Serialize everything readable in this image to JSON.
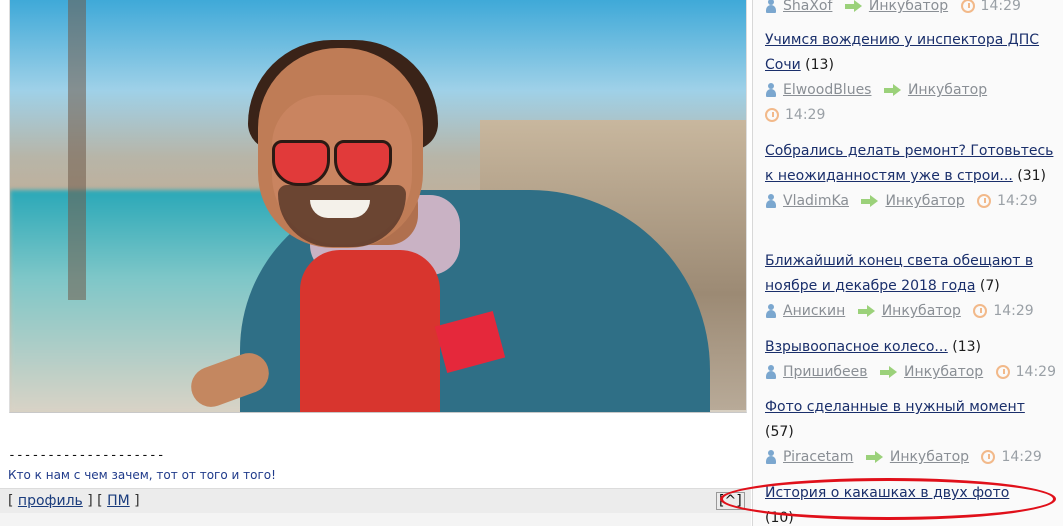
{
  "post": {
    "dashes": "--------------------",
    "signature": "Кто к нам с чем зачем, тот от того и того!",
    "bracket_open": "[",
    "bracket_close": "]",
    "profile_link": "профиль",
    "pm_link": "ПМ",
    "up_button": "[^]"
  },
  "feed": {
    "items": [
      {
        "title": "",
        "count": "",
        "user": "ShaXof",
        "forum": "Инкубатор",
        "time": "14:29"
      },
      {
        "title": "Учимся вождению у инспектора ДПС Сочи",
        "count": "(13)",
        "user": "ElwoodBlues",
        "forum": "Инкубатор",
        "time": "14:29"
      },
      {
        "title": "Собрались делать ремонт? Готовьтесь к неожиданностям уже в строи...",
        "count": "(31)",
        "user": "VladimKa",
        "forum": "Инкубатор",
        "time": "14:29"
      },
      {
        "title": "Ближайший конец света обещают в ноябре и декабре 2018 года",
        "count": "(7)",
        "user": "Анискин",
        "forum": "Инкубатор",
        "time": "14:29"
      },
      {
        "title": "Взрывоопасное колесо...",
        "count": "(13)",
        "user": "Пришибеев",
        "forum": "Инкубатор",
        "time": "14:29"
      },
      {
        "title": "Фото сделанные в нужный момент",
        "count": "(57)",
        "user": "Piracetam",
        "forum": "Инкубатор",
        "time": "14:29"
      },
      {
        "title": "История о какашках в двух фото",
        "count": "(10)",
        "user": "",
        "forum": "",
        "time": ""
      }
    ]
  }
}
